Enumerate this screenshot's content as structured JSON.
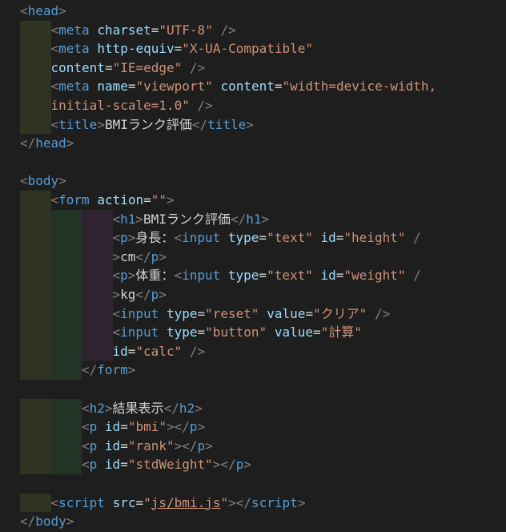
{
  "editor": {
    "lines": [
      {
        "indent": 0,
        "tokens": [
          [
            "t",
            "<"
          ],
          [
            "g",
            "head"
          ],
          [
            "t",
            ">"
          ]
        ]
      },
      {
        "indent": 1,
        "tokens": [
          [
            "t",
            "<"
          ],
          [
            "g",
            "meta"
          ],
          [
            "x",
            " "
          ],
          [
            "a",
            "charset"
          ],
          [
            "o",
            "="
          ],
          [
            "s",
            "\"UTF-8\""
          ],
          [
            "x",
            " "
          ],
          [
            "t",
            "/>"
          ]
        ]
      },
      {
        "indent": 1,
        "tokens": [
          [
            "t",
            "<"
          ],
          [
            "g",
            "meta"
          ],
          [
            "x",
            " "
          ],
          [
            "a",
            "http-equiv"
          ],
          [
            "o",
            "="
          ],
          [
            "s",
            "\"X-UA-Compatible\""
          ]
        ]
      },
      {
        "indent": 1,
        "cont": true,
        "tokens": [
          [
            "a",
            "content"
          ],
          [
            "o",
            "="
          ],
          [
            "s",
            "\"IE=edge\""
          ],
          [
            "x",
            " "
          ],
          [
            "t",
            "/>"
          ]
        ]
      },
      {
        "indent": 1,
        "tokens": [
          [
            "t",
            "<"
          ],
          [
            "g",
            "meta"
          ],
          [
            "x",
            " "
          ],
          [
            "a",
            "name"
          ],
          [
            "o",
            "="
          ],
          [
            "s",
            "\"viewport\""
          ],
          [
            "x",
            " "
          ],
          [
            "a",
            "content"
          ],
          [
            "o",
            "="
          ],
          [
            "s",
            "\"width=device-width,"
          ]
        ]
      },
      {
        "indent": 1,
        "cont": true,
        "tokens": [
          [
            "s",
            "initial-scale=1.0\""
          ],
          [
            "x",
            " "
          ],
          [
            "t",
            "/>"
          ]
        ]
      },
      {
        "indent": 1,
        "tokens": [
          [
            "t",
            "<"
          ],
          [
            "g",
            "title"
          ],
          [
            "t",
            ">"
          ],
          [
            "x",
            "BMIランク評価"
          ],
          [
            "t",
            "</"
          ],
          [
            "g",
            "title"
          ],
          [
            "t",
            ">"
          ]
        ]
      },
      {
        "indent": 0,
        "tokens": [
          [
            "t",
            "</"
          ],
          [
            "g",
            "head"
          ],
          [
            "t",
            ">"
          ]
        ]
      },
      {
        "indent": 0,
        "tokens": []
      },
      {
        "indent": 0,
        "tokens": [
          [
            "t",
            "<"
          ],
          [
            "g",
            "body"
          ],
          [
            "t",
            ">"
          ]
        ]
      },
      {
        "indent": 1,
        "tokens": [
          [
            "t",
            "<"
          ],
          [
            "g",
            "form"
          ],
          [
            "x",
            " "
          ],
          [
            "a",
            "action"
          ],
          [
            "o",
            "="
          ],
          [
            "s",
            "\"\""
          ],
          [
            "t",
            ">"
          ]
        ]
      },
      {
        "indent": 3,
        "tokens": [
          [
            "t",
            "<"
          ],
          [
            "g",
            "h1"
          ],
          [
            "t",
            ">"
          ],
          [
            "x",
            "BMIランク評価"
          ],
          [
            "t",
            "</"
          ],
          [
            "g",
            "h1"
          ],
          [
            "t",
            ">"
          ]
        ]
      },
      {
        "indent": 3,
        "tokens": [
          [
            "t",
            "<"
          ],
          [
            "g",
            "p"
          ],
          [
            "t",
            ">"
          ],
          [
            "x",
            "身長："
          ],
          [
            "t",
            "<"
          ],
          [
            "g",
            "input"
          ],
          [
            "x",
            " "
          ],
          [
            "a",
            "type"
          ],
          [
            "o",
            "="
          ],
          [
            "s",
            "\"text\""
          ],
          [
            "x",
            " "
          ],
          [
            "a",
            "id"
          ],
          [
            "o",
            "="
          ],
          [
            "s",
            "\"height\""
          ],
          [
            "x",
            " "
          ],
          [
            "t",
            "/"
          ]
        ]
      },
      {
        "indent": 3,
        "tokens": [
          [
            "t",
            ">"
          ],
          [
            "x",
            "cm"
          ],
          [
            "t",
            "</"
          ],
          [
            "g",
            "p"
          ],
          [
            "t",
            ">"
          ]
        ]
      },
      {
        "indent": 3,
        "tokens": [
          [
            "t",
            "<"
          ],
          [
            "g",
            "p"
          ],
          [
            "t",
            ">"
          ],
          [
            "x",
            "体重："
          ],
          [
            "t",
            "<"
          ],
          [
            "g",
            "input"
          ],
          [
            "x",
            " "
          ],
          [
            "a",
            "type"
          ],
          [
            "o",
            "="
          ],
          [
            "s",
            "\"text\""
          ],
          [
            "x",
            " "
          ],
          [
            "a",
            "id"
          ],
          [
            "o",
            "="
          ],
          [
            "s",
            "\"weight\""
          ],
          [
            "x",
            " "
          ],
          [
            "t",
            "/"
          ]
        ]
      },
      {
        "indent": 3,
        "tokens": [
          [
            "t",
            ">"
          ],
          [
            "x",
            "kg"
          ],
          [
            "t",
            "</"
          ],
          [
            "g",
            "p"
          ],
          [
            "t",
            ">"
          ]
        ]
      },
      {
        "indent": 3,
        "tokens": [
          [
            "t",
            "<"
          ],
          [
            "g",
            "input"
          ],
          [
            "x",
            " "
          ],
          [
            "a",
            "type"
          ],
          [
            "o",
            "="
          ],
          [
            "s",
            "\"reset\""
          ],
          [
            "x",
            " "
          ],
          [
            "a",
            "value"
          ],
          [
            "o",
            "="
          ],
          [
            "s",
            "\"クリア\""
          ],
          [
            "x",
            " "
          ],
          [
            "t",
            "/>"
          ]
        ]
      },
      {
        "indent": 3,
        "tokens": [
          [
            "t",
            "<"
          ],
          [
            "g",
            "input"
          ],
          [
            "x",
            " "
          ],
          [
            "a",
            "type"
          ],
          [
            "o",
            "="
          ],
          [
            "s",
            "\"button\""
          ],
          [
            "x",
            " "
          ],
          [
            "a",
            "value"
          ],
          [
            "o",
            "="
          ],
          [
            "s",
            "\"計算\""
          ]
        ]
      },
      {
        "indent": 3,
        "cont": true,
        "tokens": [
          [
            "a",
            "id"
          ],
          [
            "o",
            "="
          ],
          [
            "s",
            "\"calc\""
          ],
          [
            "x",
            " "
          ],
          [
            "t",
            "/>"
          ]
        ]
      },
      {
        "indent": 2,
        "tokens": [
          [
            "t",
            "</"
          ],
          [
            "g",
            "form"
          ],
          [
            "t",
            ">"
          ]
        ]
      },
      {
        "indent": 0,
        "tokens": []
      },
      {
        "indent": 2,
        "tokens": [
          [
            "t",
            "<"
          ],
          [
            "g",
            "h2"
          ],
          [
            "t",
            ">"
          ],
          [
            "x",
            "結果表示"
          ],
          [
            "t",
            "</"
          ],
          [
            "g",
            "h2"
          ],
          [
            "t",
            ">"
          ]
        ]
      },
      {
        "indent": 2,
        "tokens": [
          [
            "t",
            "<"
          ],
          [
            "g",
            "p"
          ],
          [
            "x",
            " "
          ],
          [
            "a",
            "id"
          ],
          [
            "o",
            "="
          ],
          [
            "s",
            "\"bmi\""
          ],
          [
            "t",
            "></"
          ],
          [
            "g",
            "p"
          ],
          [
            "t",
            ">"
          ]
        ]
      },
      {
        "indent": 2,
        "tokens": [
          [
            "t",
            "<"
          ],
          [
            "g",
            "p"
          ],
          [
            "x",
            " "
          ],
          [
            "a",
            "id"
          ],
          [
            "o",
            "="
          ],
          [
            "s",
            "\"rank\""
          ],
          [
            "t",
            "></"
          ],
          [
            "g",
            "p"
          ],
          [
            "t",
            ">"
          ]
        ]
      },
      {
        "indent": 2,
        "tokens": [
          [
            "t",
            "<"
          ],
          [
            "g",
            "p"
          ],
          [
            "x",
            " "
          ],
          [
            "a",
            "id"
          ],
          [
            "o",
            "="
          ],
          [
            "s",
            "\"stdWeight\""
          ],
          [
            "t",
            "></"
          ],
          [
            "g",
            "p"
          ],
          [
            "t",
            ">"
          ]
        ]
      },
      {
        "indent": 0,
        "tokens": []
      },
      {
        "indent": 1,
        "tokens": [
          [
            "t",
            "<"
          ],
          [
            "g",
            "script"
          ],
          [
            "x",
            " "
          ],
          [
            "a",
            "src"
          ],
          [
            "o",
            "="
          ],
          [
            "s",
            "\""
          ],
          [
            "su",
            "js/bmi.js"
          ],
          [
            "s",
            "\""
          ],
          [
            "t",
            "></"
          ],
          [
            "g",
            "script"
          ],
          [
            "t",
            ">"
          ]
        ]
      },
      {
        "indent": 0,
        "tokens": [
          [
            "t",
            "</"
          ],
          [
            "g",
            "body"
          ],
          [
            "t",
            ">"
          ]
        ]
      }
    ]
  },
  "colors": {
    "background": "#1e1e1e",
    "guide_level1": "#2f3322",
    "guide_level2": "#233427",
    "guide_level3": "#2f2332",
    "tag": "#569cd6",
    "attribute": "#9cdcfe",
    "string": "#ce9178",
    "text": "#d4d4d4",
    "bracket": "#808080"
  }
}
